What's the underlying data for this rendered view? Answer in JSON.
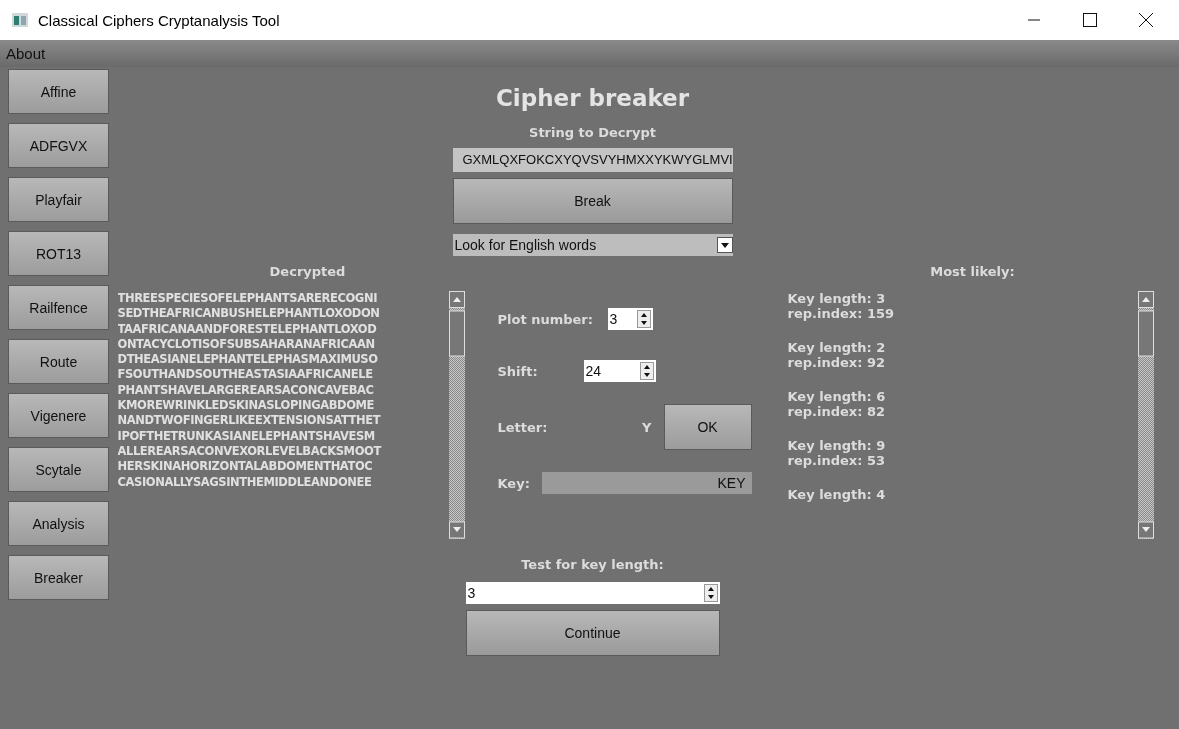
{
  "window": {
    "title": "Classical Ciphers Cryptanalysis Tool"
  },
  "menu": [
    "About"
  ],
  "sidebar": {
    "items": [
      "Affine",
      "ADFGVX",
      "Playfair",
      "ROT13",
      "Railfence",
      "Route",
      "Vigenere",
      "Scytale",
      "Analysis",
      "Breaker"
    ]
  },
  "heading": "Cipher breaker",
  "string_to_decrypt": {
    "label": "String to Decrypt",
    "value": "GXMLQXFOKCXYQVSVYHMXXYKWYGLMVI"
  },
  "break_button": "Break",
  "mode_select": {
    "value": "Look for English words"
  },
  "decrypted": {
    "label": "Decrypted",
    "lines": [
      "THREESPECIESOFELEPHANTSARERECOGNI",
      "SEDTHEAFRICANBUSHELEPHANTLOXODON",
      "TAAFRICANAANDFORESTELEPHANTLOXOD",
      "ONTACYCLOTISOFSUBSAHARANAFRICAAN",
      "DTHEASIANELEPHANTELEPHASMAXIMUSO",
      "FSOUTHANDSOUTHEASTASIAAFRICANELE",
      "PHANTSHAVELARGEREARSACONCAVEBAC",
      "KMOREWRINKLEDSKINASLOPINGABDOME",
      "NANDTWOFINGERLIKEEXTENSIONSATTHET",
      "IPOFTHETRUNKASIANELEPHANTSHAVESM",
      "ALLEREARSACONVEXORLEVELBACKSMOOT",
      "HERSKINAHORIZONTALABDOMENTHATOC",
      "CASIONALLYSAGSINTHEMIDDLEANDONEE"
    ]
  },
  "controls": {
    "plot_number": {
      "label": "Plot number:",
      "value": "3"
    },
    "shift": {
      "label": "Shift:",
      "value": "24"
    },
    "letter": {
      "label": "Letter:",
      "value": "Y",
      "button": "OK"
    },
    "key": {
      "label": "Key:",
      "value": "KEY"
    }
  },
  "most_likely": {
    "label": "Most likely:",
    "items": [
      {
        "key_length": "Key length: 3",
        "rep_index": "rep.index: 159"
      },
      {
        "key_length": "Key length: 2",
        "rep_index": "rep.index: 92"
      },
      {
        "key_length": "Key length: 6",
        "rep_index": "rep.index: 82"
      },
      {
        "key_length": "Key length: 9",
        "rep_index": "rep.index: 53"
      },
      {
        "key_length": "Key length: 4"
      }
    ]
  },
  "test_key_length": {
    "label": "Test for key length:",
    "value": "3",
    "button": "Continue"
  }
}
